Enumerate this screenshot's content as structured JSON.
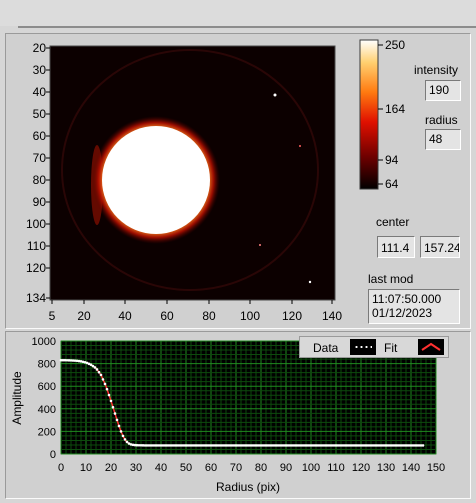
{
  "image_plot": {
    "y_ticks": [
      "20",
      "30",
      "40",
      "50",
      "60",
      "70",
      "80",
      "90",
      "100",
      "110",
      "120",
      "134"
    ],
    "x_ticks": [
      "5",
      "20",
      "40",
      "60",
      "80",
      "100",
      "120",
      "140"
    ]
  },
  "colorbar": {
    "ticks": [
      "250",
      "164",
      "94",
      "64"
    ],
    "colors": [
      "#000000",
      "#6e0000",
      "#d40000",
      "#ff5a00",
      "#ffc040",
      "#ffffff"
    ]
  },
  "intensity": {
    "label": "intensity",
    "value": "190"
  },
  "radius": {
    "label": "radius",
    "value": "48"
  },
  "center": {
    "label": "center",
    "x": "111.4",
    "y": "157.24"
  },
  "last_mod": {
    "label": "last mod",
    "time": "11:07:50.000",
    "date": "01/12/2023"
  },
  "legend": {
    "data_label": "Data",
    "fit_label": "Fit"
  },
  "chart_data": {
    "type": "line",
    "xlabel": "Radius (pix)",
    "ylabel": "Amplitude",
    "xlim": [
      0,
      150
    ],
    "ylim": [
      0,
      1000
    ],
    "x_ticks": [
      "0",
      "10",
      "20",
      "30",
      "40",
      "50",
      "60",
      "70",
      "80",
      "90",
      "100",
      "110",
      "120",
      "130",
      "140",
      "150"
    ],
    "y_ticks": [
      "0",
      "200",
      "400",
      "600",
      "800",
      "1000"
    ],
    "grid": true,
    "legend_placement": "top-right",
    "series": [
      {
        "name": "Data",
        "x": [
          0,
          2,
          4,
          6,
          8,
          10,
          12,
          14,
          16,
          18,
          20,
          21,
          22,
          23,
          24,
          25,
          26,
          27,
          28,
          29,
          30,
          32,
          34,
          36,
          40,
          50,
          60,
          70,
          80,
          90,
          100,
          110,
          120,
          130,
          140,
          145
        ],
        "y": [
          830,
          830,
          828,
          826,
          820,
          810,
          790,
          760,
          700,
          600,
          470,
          400,
          330,
          260,
          200,
          150,
          115,
          95,
          85,
          80,
          78,
          77,
          76,
          76,
          76,
          76,
          76,
          76,
          76,
          76,
          76,
          76,
          76,
          76,
          76,
          76
        ]
      },
      {
        "name": "Fit",
        "x": [
          0,
          2,
          4,
          6,
          8,
          10,
          12,
          14,
          16,
          18,
          20,
          21,
          22,
          23,
          24,
          25,
          26,
          27,
          28,
          29,
          30,
          32,
          34,
          36,
          40,
          50,
          60,
          70,
          80,
          90,
          100,
          110,
          120,
          130,
          140,
          145
        ],
        "y": [
          830,
          830,
          828,
          826,
          820,
          810,
          790,
          760,
          700,
          600,
          470,
          400,
          330,
          260,
          200,
          150,
          115,
          95,
          85,
          80,
          78,
          77,
          76,
          76,
          76,
          76,
          76,
          76,
          76,
          76,
          76,
          76,
          76,
          76,
          76,
          76
        ]
      }
    ]
  }
}
